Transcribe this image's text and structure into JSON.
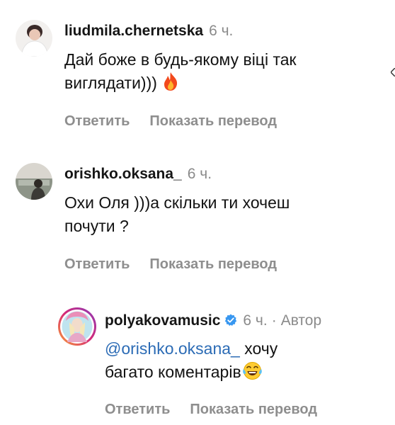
{
  "comments": [
    {
      "username": "liudmila.chernetska",
      "time": "6 ч.",
      "text_lines": [
        "Дай боже в будь-якому віці так",
        "виглядати)))"
      ],
      "emoji": "fire-emoji",
      "reply_label": "Ответить",
      "translate_label": "Показать перевод"
    },
    {
      "username": "orishko.oksana_",
      "time": "6 ч.",
      "text_lines": [
        "Охи Оля )))а скільки ти хочеш",
        "почути ?"
      ],
      "reply_label": "Ответить",
      "translate_label": "Показать перевод"
    },
    {
      "username": "polyakovamusic",
      "verified": true,
      "time": "6 ч.",
      "separator": "·",
      "author_label": "Автор",
      "mention": "@orishko.oksana_",
      "text_line1_rest": " хочу",
      "text_line2": "багато коментарів",
      "emoji": "tears-of-joy-emoji",
      "reply_label": "Ответить",
      "translate_label": "Показать перевод"
    }
  ],
  "colors": {
    "username": "#161616",
    "meta": "#8a8a8a",
    "action": "#8e8e8e",
    "mention": "#2b6bb5",
    "verified": "#3897f0",
    "story_ring": "#d62976"
  }
}
